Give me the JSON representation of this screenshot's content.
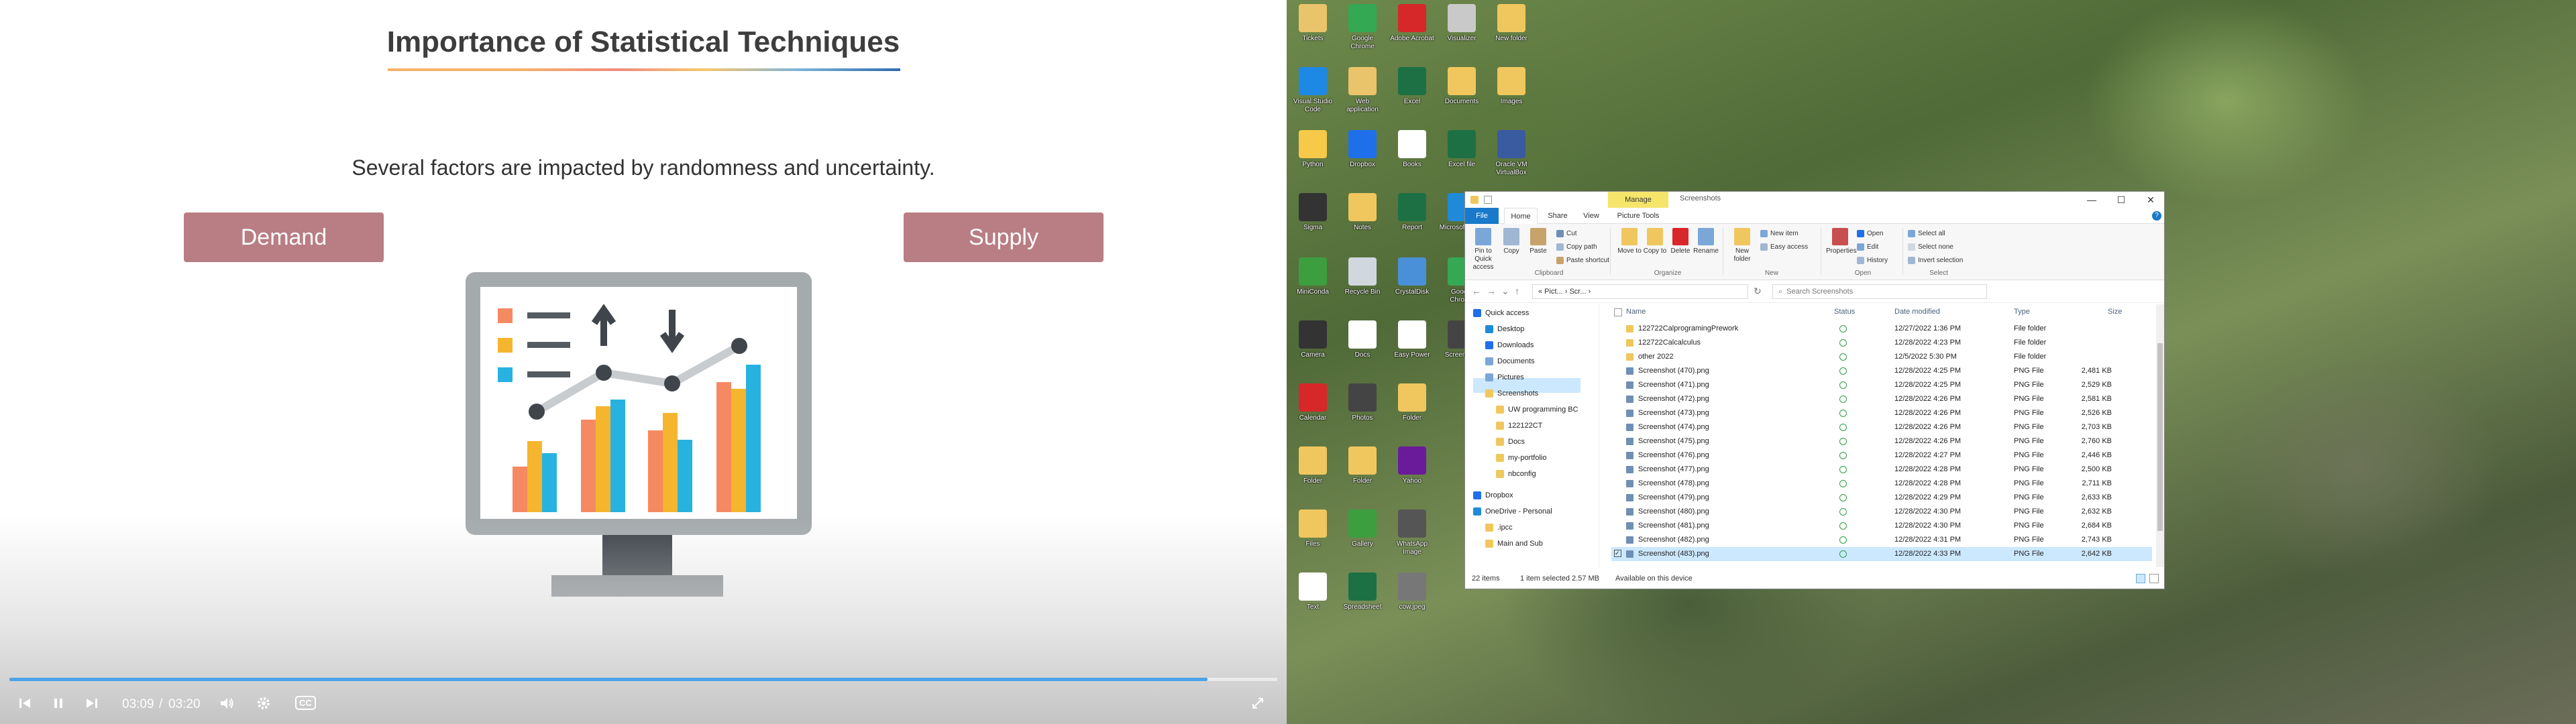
{
  "video": {
    "slide_title": "Importance of Statistical Techniques",
    "subtitle": "Several factors are impacted by randomness and uncertainty.",
    "pill_left": "Demand",
    "pill_right": "Supply",
    "time_current": "03:09",
    "time_separator": "/",
    "time_total": "03:20",
    "progress": 0.945,
    "cc_label": "CC",
    "icons": {
      "prev": "skip-back-icon",
      "pause": "pause-icon",
      "next": "skip-forward-icon",
      "volume": "volume-icon",
      "settings": "gear-icon",
      "fullscreen": "fullscreen-icon"
    }
  },
  "desktop": {
    "icons": [
      {
        "label": "Tickets",
        "color": "#e9c46a"
      },
      {
        "label": "Google Chrome",
        "color": "#34a853"
      },
      {
        "label": "Adobe Acrobat",
        "color": "#d62828"
      },
      {
        "label": "Visualizer",
        "color": "#c9c9c9"
      },
      {
        "label": "New folder",
        "color": "#f0c75e"
      },
      {
        "label": "Visual Studio Code",
        "color": "#1e88e5"
      },
      {
        "label": "Web application",
        "color": "#e9c46a"
      },
      {
        "label": "Excel",
        "color": "#1d7044"
      },
      {
        "label": "Documents",
        "color": "#f0c75e"
      },
      {
        "label": "Images",
        "color": "#f0c75e"
      },
      {
        "label": "Python",
        "color": "#f7c948"
      },
      {
        "label": "Dropbox",
        "color": "#1f6feb"
      },
      {
        "label": "Books",
        "color": "#ffffff"
      },
      {
        "label": "Excel file",
        "color": "#1d7044"
      },
      {
        "label": "Oracle VM VirtualBox",
        "color": "#3a5ba0"
      },
      {
        "label": "Sigma",
        "color": "#333333"
      },
      {
        "label": "Notes",
        "color": "#f0c75e"
      },
      {
        "label": "Report",
        "color": "#1d7044"
      },
      {
        "label": "Microsoft Edge",
        "color": "#1f8ad8"
      },
      {
        "label": "MiniConda",
        "color": "#3c9e3f"
      },
      {
        "label": "Recycle Bin",
        "color": "#d0d7de"
      },
      {
        "label": "CrystalDisk",
        "color": "#4a90d9"
      },
      {
        "label": "Google Chrome",
        "color": "#34a853"
      },
      {
        "label": "Camera",
        "color": "#333333"
      },
      {
        "label": "Docs",
        "color": "#ffffff"
      },
      {
        "label": "Easy Power",
        "color": "#ffffff"
      },
      {
        "label": "Screenshot",
        "color": "#444444"
      },
      {
        "label": "Calendar",
        "color": "#d62828"
      },
      {
        "label": "Photos",
        "color": "#444444"
      },
      {
        "label": "Folder",
        "color": "#f0c75e"
      },
      {
        "label": "Folder",
        "color": "#f0c75e"
      },
      {
        "label": "Folder",
        "color": "#f0c75e"
      },
      {
        "label": "Yahoo",
        "color": "#6a1b9a"
      },
      {
        "label": "Files",
        "color": "#f0c75e"
      },
      {
        "label": "Gallery",
        "color": "#3c9e3f"
      },
      {
        "label": "WhatsApp Image",
        "color": "#555555"
      },
      {
        "label": "Text",
        "color": "#ffffff"
      },
      {
        "label": "Spreadsheet",
        "color": "#1d7044"
      },
      {
        "label": "cow.jpeg",
        "color": "#777777"
      }
    ]
  },
  "explorer": {
    "manage_label": "Manage",
    "window_title": "Screenshots",
    "tabs": [
      "File",
      "Home",
      "Share",
      "View",
      "Picture Tools"
    ],
    "ribbon": {
      "pin": "Pin to Quick access",
      "copy": "Copy",
      "paste": "Paste",
      "cut": "Cut",
      "copy_path": "Copy path",
      "paste_shortcut": "Paste shortcut",
      "clipboard": "Clipboard",
      "move_to": "Move to",
      "copy_to": "Copy to",
      "delete": "Delete",
      "rename": "Rename",
      "organize": "Organize",
      "new_folder": "New folder",
      "new_item": "New item",
      "easy_access": "Easy access",
      "new_group": "New",
      "properties": "Properties",
      "open": "Open",
      "edit": "Edit",
      "history": "History",
      "open_group": "Open",
      "select_all": "Select all",
      "select_none": "Select none",
      "invert_selection": "Invert selection",
      "select_group": "Select"
    },
    "address": "« Pict... › Scr... ›",
    "search_placeholder": "Search Screenshots",
    "nav": [
      "Quick access",
      "Desktop",
      "Downloads",
      "Documents",
      "Pictures",
      "Screenshots",
      "UW programming BC",
      "122122CT",
      "Docs",
      "my-portfolio",
      "nbconfig",
      "Dropbox",
      "OneDrive - Personal",
      ".ipcc",
      "Main and Sub"
    ],
    "columns": [
      "Name",
      "Status",
      "Date modified",
      "Type",
      "Size"
    ],
    "files": [
      {
        "name": "122722CalprogramingPrework",
        "date": "12/27/2022 1:36 PM",
        "type": "File folder",
        "size": "",
        "folder": true
      },
      {
        "name": "122722Calcalculus",
        "date": "12/28/2022 4:23 PM",
        "type": "File folder",
        "size": "",
        "folder": true
      },
      {
        "name": "other 2022",
        "date": "12/5/2022 5:30 PM",
        "type": "File folder",
        "size": "",
        "folder": true
      },
      {
        "name": "Screenshot (470).png",
        "date": "12/28/2022 4:25 PM",
        "type": "PNG File",
        "size": "2,481 KB",
        "folder": false
      },
      {
        "name": "Screenshot (471).png",
        "date": "12/28/2022 4:25 PM",
        "type": "PNG File",
        "size": "2,529 KB",
        "folder": false
      },
      {
        "name": "Screenshot (472).png",
        "date": "12/28/2022 4:26 PM",
        "type": "PNG File",
        "size": "2,581 KB",
        "folder": false
      },
      {
        "name": "Screenshot (473).png",
        "date": "12/28/2022 4:26 PM",
        "type": "PNG File",
        "size": "2,526 KB",
        "folder": false
      },
      {
        "name": "Screenshot (474).png",
        "date": "12/28/2022 4:26 PM",
        "type": "PNG File",
        "size": "2,703 KB",
        "folder": false
      },
      {
        "name": "Screenshot (475).png",
        "date": "12/28/2022 4:26 PM",
        "type": "PNG File",
        "size": "2,760 KB",
        "folder": false
      },
      {
        "name": "Screenshot (476).png",
        "date": "12/28/2022 4:27 PM",
        "type": "PNG File",
        "size": "2,446 KB",
        "folder": false
      },
      {
        "name": "Screenshot (477).png",
        "date": "12/28/2022 4:28 PM",
        "type": "PNG File",
        "size": "2,500 KB",
        "folder": false
      },
      {
        "name": "Screenshot (478).png",
        "date": "12/28/2022 4:28 PM",
        "type": "PNG File",
        "size": "2,711 KB",
        "folder": false
      },
      {
        "name": "Screenshot (479).png",
        "date": "12/28/2022 4:29 PM",
        "type": "PNG File",
        "size": "2,633 KB",
        "folder": false
      },
      {
        "name": "Screenshot (480).png",
        "date": "12/28/2022 4:30 PM",
        "type": "PNG File",
        "size": "2,632 KB",
        "folder": false
      },
      {
        "name": "Screenshot (481).png",
        "date": "12/28/2022 4:30 PM",
        "type": "PNG File",
        "size": "2,684 KB",
        "folder": false
      },
      {
        "name": "Screenshot (482).png",
        "date": "12/28/2022 4:31 PM",
        "type": "PNG File",
        "size": "2,743 KB",
        "folder": false
      },
      {
        "name": "Screenshot (483).png",
        "date": "12/28/2022 4:33 PM",
        "type": "PNG File",
        "size": "2,642 KB",
        "folder": false,
        "selected": true
      }
    ],
    "status_items": "22 items",
    "status_selected": "1 item selected 2.57 MB",
    "status_device": "Available on this device"
  }
}
